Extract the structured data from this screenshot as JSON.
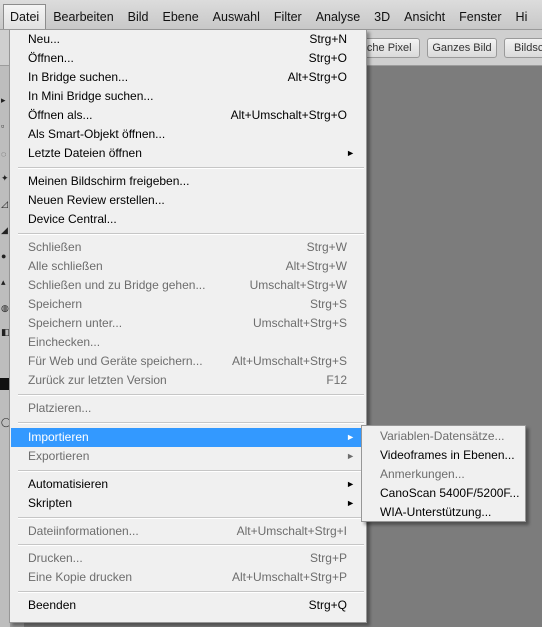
{
  "menubar": {
    "items": [
      {
        "label": "Datei"
      },
      {
        "label": "Bearbeiten"
      },
      {
        "label": "Bild"
      },
      {
        "label": "Ebene"
      },
      {
        "label": "Auswahl"
      },
      {
        "label": "Filter"
      },
      {
        "label": "Analyse"
      },
      {
        "label": "3D"
      },
      {
        "label": "Ansicht"
      },
      {
        "label": "Fenster"
      },
      {
        "label": "Hi"
      }
    ]
  },
  "options_bar": {
    "buttons": [
      {
        "label": "iche Pixel"
      },
      {
        "label": "Ganzes Bild"
      },
      {
        "label": "Bildsch"
      }
    ]
  },
  "file_menu": {
    "items": [
      {
        "label": "Neu...",
        "shortcut": "Strg+N"
      },
      {
        "label": "Öffnen...",
        "shortcut": "Strg+O"
      },
      {
        "label": "In Bridge suchen...",
        "shortcut": "Alt+Strg+O"
      },
      {
        "label": "In Mini Bridge suchen...",
        "shortcut": ""
      },
      {
        "label": "Öffnen als...",
        "shortcut": "Alt+Umschalt+Strg+O"
      },
      {
        "label": "Als Smart-Objekt öffnen...",
        "shortcut": ""
      },
      {
        "label": "Letzte Dateien öffnen",
        "shortcut": ""
      },
      {
        "label": "Meinen Bildschirm freigeben...",
        "shortcut": ""
      },
      {
        "label": "Neuen Review erstellen...",
        "shortcut": ""
      },
      {
        "label": "Device Central...",
        "shortcut": ""
      },
      {
        "label": "Schließen",
        "shortcut": "Strg+W"
      },
      {
        "label": "Alle schließen",
        "shortcut": "Alt+Strg+W"
      },
      {
        "label": "Schließen und zu Bridge gehen...",
        "shortcut": "Umschalt+Strg+W"
      },
      {
        "label": "Speichern",
        "shortcut": "Strg+S"
      },
      {
        "label": "Speichern unter...",
        "shortcut": "Umschalt+Strg+S"
      },
      {
        "label": "Einchecken...",
        "shortcut": ""
      },
      {
        "label": "Für Web und Geräte speichern...",
        "shortcut": "Alt+Umschalt+Strg+S"
      },
      {
        "label": "Zurück zur letzten Version",
        "shortcut": "F12"
      },
      {
        "label": "Platzieren...",
        "shortcut": ""
      },
      {
        "label": "Importieren",
        "shortcut": ""
      },
      {
        "label": "Exportieren",
        "shortcut": ""
      },
      {
        "label": "Automatisieren",
        "shortcut": ""
      },
      {
        "label": "Skripten",
        "shortcut": ""
      },
      {
        "label": "Dateiinformationen...",
        "shortcut": "Alt+Umschalt+Strg+I"
      },
      {
        "label": "Drucken...",
        "shortcut": "Strg+P"
      },
      {
        "label": "Eine Kopie drucken",
        "shortcut": "Alt+Umschalt+Strg+P"
      },
      {
        "label": "Beenden",
        "shortcut": "Strg+Q"
      }
    ]
  },
  "import_submenu": {
    "items": [
      {
        "label": "Variablen-Datensätze..."
      },
      {
        "label": "Videoframes in Ebenen..."
      },
      {
        "label": "Anmerkungen..."
      },
      {
        "label": "CanoScan 5400F/5200F..."
      },
      {
        "label": "WIA-Unterstützung..."
      }
    ]
  },
  "submenu_arrow": "►",
  "colors": {
    "highlight": "#3399ff",
    "menu_bg": "#f0f0f0",
    "disabled_text": "#6d6d6d",
    "workspace": "#7c7c7c"
  }
}
